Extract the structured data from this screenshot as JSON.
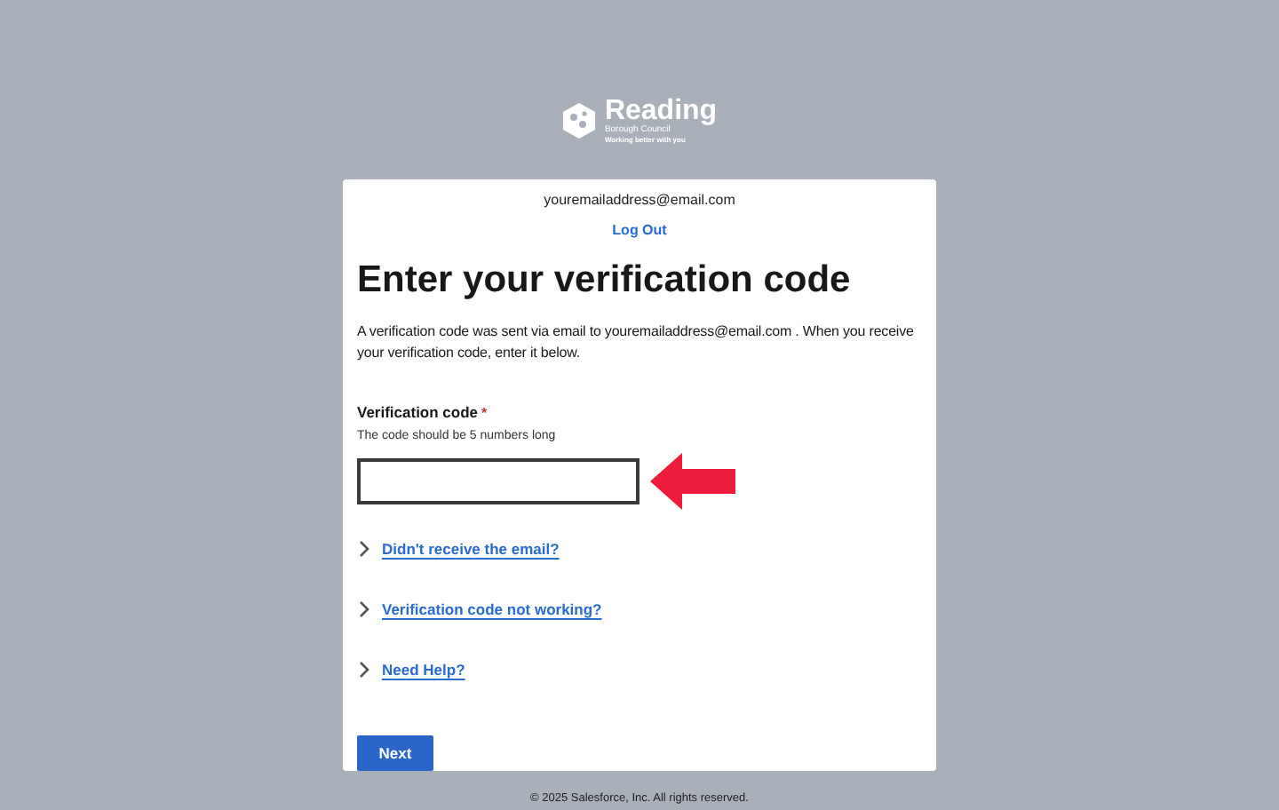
{
  "logo": {
    "name": "Reading",
    "subtitle": "Borough Council",
    "tagline": "Working better with you"
  },
  "account": {
    "email": "youremailaddress@email.com",
    "logout": "Log Out"
  },
  "heading": "Enter your verification code",
  "message": "A verification code was sent via email to youremailaddress@email.com . When you receive your verification code, enter it below.",
  "field": {
    "label": "Verification code",
    "required_mark": "*",
    "hint": "The code should be 5 numbers long"
  },
  "sections": [
    {
      "label": "Didn't receive the email?",
      "expanded": false
    },
    {
      "label": "Verification code not working?",
      "expanded": false
    },
    {
      "label": "Need Help?",
      "expanded": false
    }
  ],
  "button": "Next",
  "footer": "© 2025 Salesforce, Inc. All rights reserved."
}
